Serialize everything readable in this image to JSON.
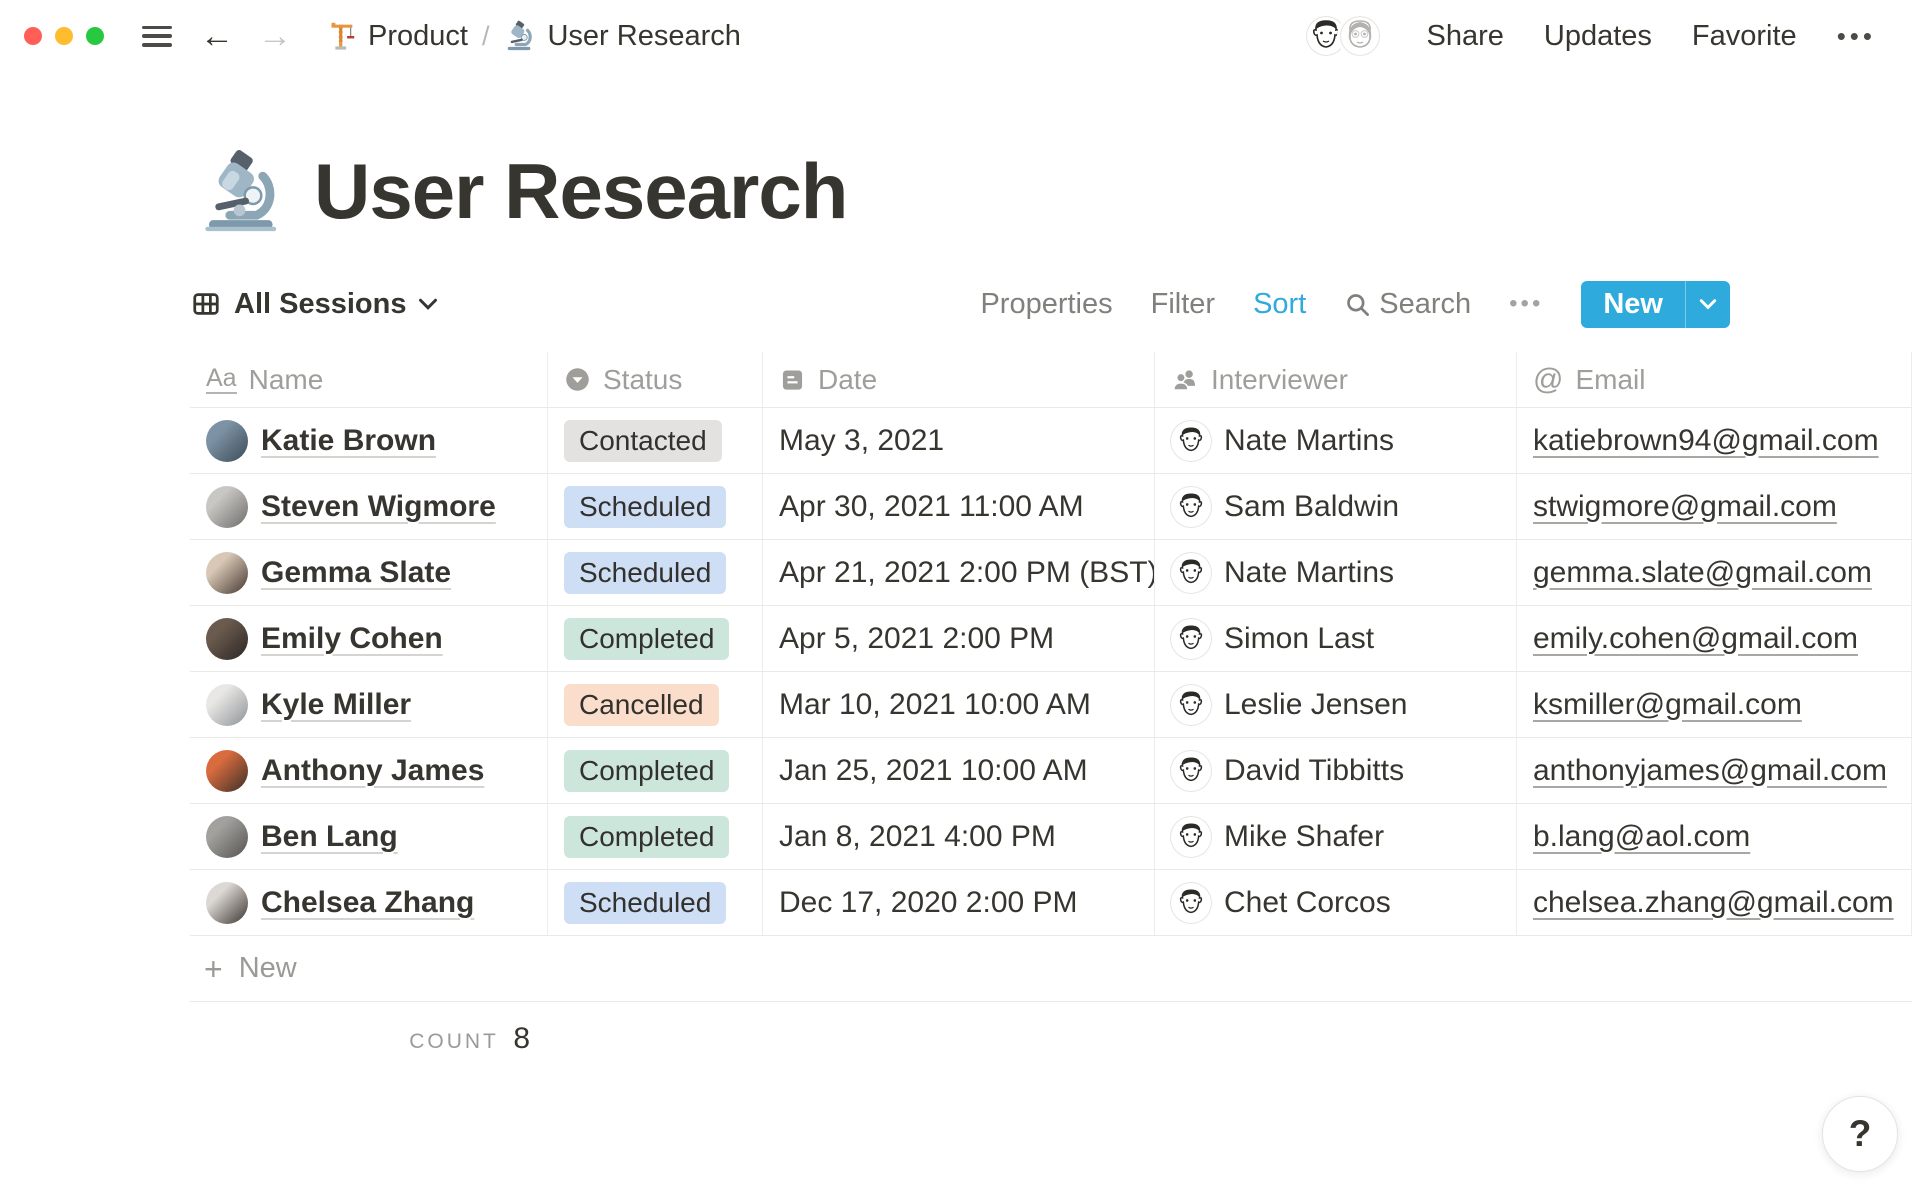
{
  "window": {
    "traffic_lights": [
      "#FF5F57",
      "#FEBC2E",
      "#28C840"
    ]
  },
  "topbar": {
    "back_icon": "←",
    "forward_icon": "→",
    "breadcrumb": [
      {
        "icon": "crane-icon",
        "label": "Product"
      },
      {
        "icon": "microscope-icon",
        "label": "User Research"
      }
    ],
    "separator": "/",
    "share_label": "Share",
    "updates_label": "Updates",
    "favorite_label": "Favorite",
    "more_icon": "•••"
  },
  "page": {
    "icon": "microscope-icon",
    "title": "User Research"
  },
  "toolbar": {
    "view_label": "All Sessions",
    "properties_label": "Properties",
    "filter_label": "Filter",
    "sort_label": "Sort",
    "search_label": "Search",
    "more_icon": "•••",
    "new_label": "New",
    "accent_color": "#2EAADC"
  },
  "table": {
    "columns": [
      {
        "label": "Name",
        "icon": "text-icon",
        "icon_glyph": "Aa"
      },
      {
        "label": "Status",
        "icon": "select-icon"
      },
      {
        "label": "Date",
        "icon": "calendar-icon"
      },
      {
        "label": "Interviewer",
        "icon": "person-icon"
      },
      {
        "label": "Email",
        "icon": "at-icon",
        "icon_glyph": "@"
      }
    ],
    "status_styles": {
      "Contacted": "#E3E2E0",
      "Scheduled": "#CDDEF5",
      "Completed": "#CDE6DB",
      "Cancelled": "#FADDCB"
    },
    "rows": [
      {
        "name": "Katie Brown",
        "status": "Contacted",
        "date": "May 3, 2021",
        "interviewer": "Nate Martins",
        "email": "katiebrown94@gmail.com",
        "avatar": {
          "c1": "#7d93a5",
          "c2": "#3c4a57"
        }
      },
      {
        "name": "Steven Wigmore",
        "status": "Scheduled",
        "date": "Apr 30, 2021 11:00 AM",
        "interviewer": "Sam Baldwin",
        "email": "stwigmore@gmail.com",
        "avatar": {
          "c1": "#c9c7c4",
          "c2": "#6e6c68"
        }
      },
      {
        "name": "Gemma Slate",
        "status": "Scheduled",
        "date": "Apr 21, 2021 2:00 PM (BST)",
        "interviewer": "Nate Martins",
        "email": "gemma.slate@gmail.com",
        "avatar": {
          "c1": "#d9c8b6",
          "c2": "#43372f"
        }
      },
      {
        "name": "Emily Cohen",
        "status": "Completed",
        "date": "Apr 5, 2021 2:00 PM",
        "interviewer": "Simon Last",
        "email": "emily.cohen@gmail.com",
        "avatar": {
          "c1": "#6b5b4e",
          "c2": "#2b2624"
        }
      },
      {
        "name": "Kyle Miller",
        "status": "Cancelled",
        "date": "Mar 10, 2021 10:00 AM",
        "interviewer": "Leslie Jensen",
        "email": "ksmiller@gmail.com",
        "avatar": {
          "c1": "#e9e7e4",
          "c2": "#8d9297"
        }
      },
      {
        "name": "Anthony James",
        "status": "Completed",
        "date": "Jan 25, 2021 10:00 AM",
        "interviewer": "David Tibbitts",
        "email": "anthonyjames@gmail.com",
        "avatar": {
          "c1": "#d96c3f",
          "c2": "#3a2e28"
        }
      },
      {
        "name": "Ben Lang",
        "status": "Completed",
        "date": "Jan 8, 2021 4:00 PM",
        "interviewer": "Mike Shafer",
        "email": "b.lang@aol.com",
        "avatar": {
          "c1": "#a3a19e",
          "c2": "#55534f"
        }
      },
      {
        "name": "Chelsea Zhang",
        "status": "Scheduled",
        "date": "Dec 17, 2020 2:00 PM",
        "interviewer": "Chet Corcos",
        "email": "chelsea.zhang@gmail.com",
        "avatar": {
          "c1": "#dcd8d3",
          "c2": "#3b3430"
        }
      }
    ],
    "new_row_label": "New",
    "plus_icon": "+",
    "count_label": "COUNT",
    "count_value": "8"
  },
  "help": {
    "label": "?"
  }
}
